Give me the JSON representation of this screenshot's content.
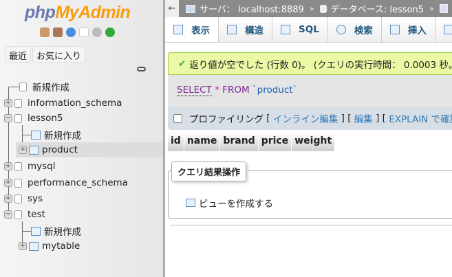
{
  "sidebar": {
    "logo_php": "php",
    "logo_my": "MyAdmin",
    "recent": "最近",
    "favorites": "お気に入り",
    "tree": [
      {
        "label": "新規作成",
        "type": "new-db"
      },
      {
        "label": "information_schema",
        "type": "db"
      },
      {
        "label": "lesson5",
        "type": "db"
      },
      {
        "label": "新規作成",
        "type": "new-table"
      },
      {
        "label": "product",
        "type": "table"
      },
      {
        "label": "mysql",
        "type": "db"
      },
      {
        "label": "performance_schema",
        "type": "db"
      },
      {
        "label": "sys",
        "type": "db"
      },
      {
        "label": "test",
        "type": "db"
      },
      {
        "label": "新規作成",
        "type": "new-table"
      },
      {
        "label": "mytable",
        "type": "table"
      }
    ]
  },
  "breadcrumb": {
    "back": "←",
    "server": "サーバ： localhost:8889",
    "sep": "»",
    "database": "データベース: lesson5",
    "sep2": "»"
  },
  "tabs": [
    "表示",
    "構造",
    "SQL",
    "検索",
    "挿入"
  ],
  "message": "返り値が空でした (行数 0)。 (クエリの実行時間： 0.0003 秒。",
  "sql": {
    "select": "SELECT",
    "star": "*",
    "from": "FROM",
    "table": "`product`"
  },
  "profiling": {
    "label": "プロファイリング",
    "b1": "[",
    "inline_edit": "インライン編集",
    "b2": "] [",
    "edit": "編集",
    "b3": "] [",
    "explain": "EXPLAIN で確認"
  },
  "columns": [
    "id",
    "name",
    "brand",
    "price",
    "weight"
  ],
  "ops": {
    "legend": "クエリ結果操作",
    "create_view": "ビューを作成する"
  }
}
